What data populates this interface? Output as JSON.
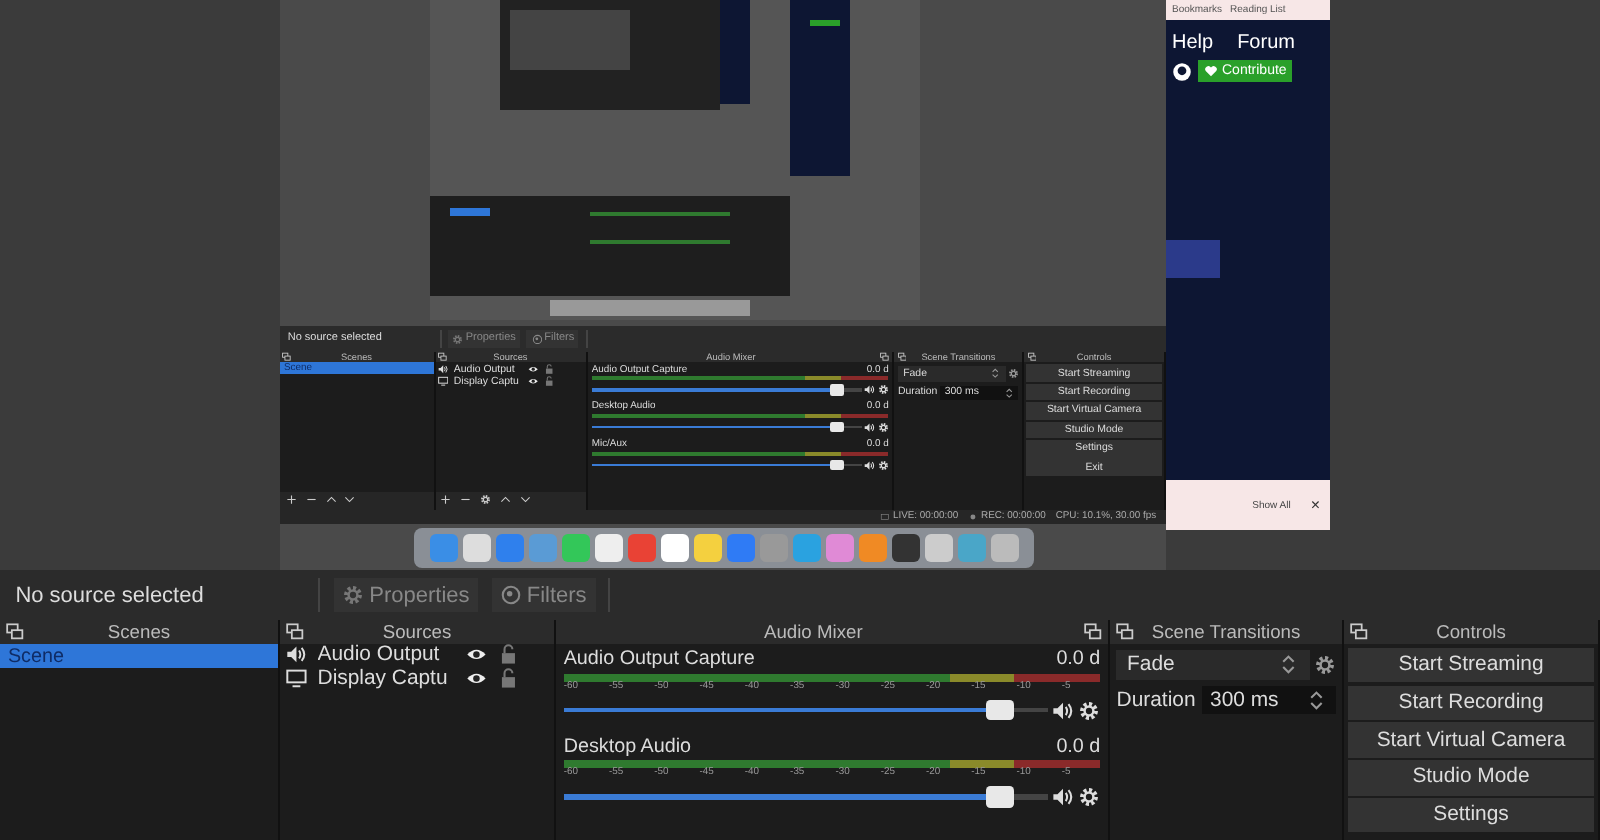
{
  "preview": {
    "browser": {
      "bookmarks": "Bookmarks",
      "reading_list": "Reading List",
      "nav": [
        "Help",
        "Forum"
      ],
      "contribute": "Contribute",
      "show_all": "Show All",
      "close": "×"
    },
    "nested_obs": {
      "source_status": "No source selected",
      "properties": "Properties",
      "filters": "Filters",
      "panels": {
        "scenes": "Scenes",
        "sources": "Sources",
        "mixer": "Audio Mixer",
        "transitions": "Scene Transitions",
        "controls": "Controls"
      },
      "scenes": [
        {
          "name": "Scene",
          "selected": true
        }
      ],
      "sources": [
        {
          "kind": "audio",
          "name": "Audio Output",
          "visible": true,
          "locked": false
        },
        {
          "kind": "display",
          "name": "Display Captu",
          "visible": true,
          "locked": false
        }
      ],
      "mixer": [
        {
          "name": "Audio Output Capture",
          "reading": "0.0 d",
          "level": 0.93
        },
        {
          "name": "Desktop Audio",
          "reading": "0.0 d",
          "level": 0.93
        },
        {
          "name": "Mic/Aux",
          "reading": "0.0 d",
          "level": 0.93
        }
      ],
      "transition": {
        "value": "Fade",
        "duration_label": "Duration",
        "duration": "300 ms"
      },
      "controls": [
        "Start Streaming",
        "Start Recording",
        "Start Virtual Camera",
        "Studio Mode",
        "Settings",
        "Exit"
      ],
      "status_bar": {
        "live": "LIVE: 00:00:00",
        "rec": "REC: 00:00:00",
        "cpu": "CPU: 10.1%, 30.00 fps"
      }
    }
  },
  "obs": {
    "source_status": "No source selected",
    "properties": "Properties",
    "filters": "Filters",
    "panels": {
      "scenes": "Scenes",
      "sources": "Sources",
      "mixer": "Audio Mixer",
      "transitions": "Scene Transitions",
      "controls": "Controls"
    },
    "scenes": [
      {
        "name": "Scene",
        "selected": true
      }
    ],
    "sources": [
      {
        "kind": "audio",
        "name": "Audio Output",
        "visible": true,
        "locked": false
      },
      {
        "kind": "display",
        "name": "Display Captu",
        "visible": true,
        "locked": false
      }
    ],
    "mixer": [
      {
        "name": "Audio Output Capture",
        "reading": "0.0 d",
        "level": 0.93,
        "ticks": [
          "-60",
          "-55",
          "-50",
          "-45",
          "-40",
          "-35",
          "-30",
          "-25",
          "-20",
          "-15",
          "-10",
          "-5"
        ]
      },
      {
        "name": "Desktop Audio",
        "reading": "0.0 d",
        "level": 0.93,
        "ticks": [
          "-60",
          "-55",
          "-50",
          "-45",
          "-40",
          "-35",
          "-30",
          "-25",
          "-20",
          "-15",
          "-10",
          "-5"
        ]
      }
    ],
    "transition": {
      "value": "Fade",
      "duration_label": "Duration",
      "duration": "300 ms"
    },
    "controls": [
      "Start Streaming",
      "Start Recording",
      "Start Virtual Camera",
      "Studio Mode",
      "Settings"
    ]
  }
}
